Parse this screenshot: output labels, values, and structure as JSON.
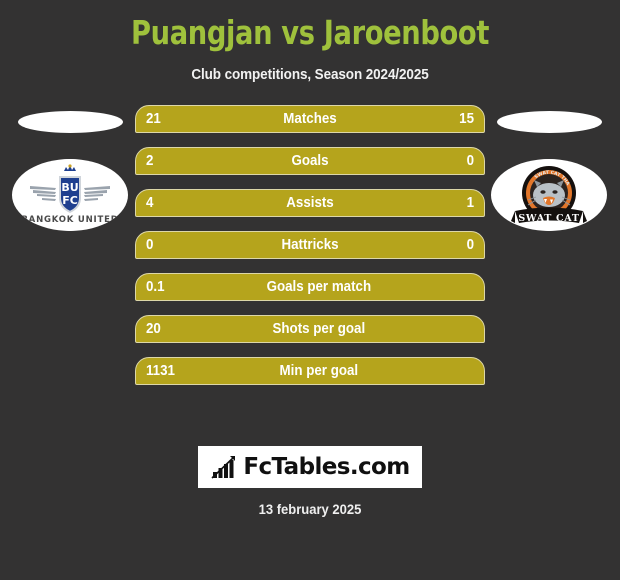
{
  "header": {
    "title": "Puangjan vs Jaroenboot",
    "subtitle": "Club competitions, Season 2024/2025",
    "title_color": "#9fc13c",
    "background_color": "#333232"
  },
  "teams": {
    "home": {
      "crest_name": "bangkok-united-crest",
      "crest_text": "BANGKOK UNITED",
      "crest_monogram_top": "BU",
      "crest_monogram_bottom": "FC",
      "crest_primary_color": "#1f3f8f"
    },
    "away": {
      "crest_name": "swat-cat-crest",
      "crest_text": "SWAT CAT",
      "crest_primary_color": "#e2762a"
    }
  },
  "stats": {
    "row_color": "#b5a41c",
    "row_border_color": "#ddd7a8",
    "rows": [
      {
        "label": "Matches",
        "home": "21",
        "away": "15",
        "has_away": true
      },
      {
        "label": "Goals",
        "home": "2",
        "away": "0",
        "has_away": true
      },
      {
        "label": "Assists",
        "home": "4",
        "away": "1",
        "has_away": true
      },
      {
        "label": "Hattricks",
        "home": "0",
        "away": "0",
        "has_away": true
      },
      {
        "label": "Goals per match",
        "home": "0.1",
        "away": "",
        "has_away": false
      },
      {
        "label": "Shots per goal",
        "home": "20",
        "away": "",
        "has_away": false
      },
      {
        "label": "Min per goal",
        "home": "1131",
        "away": "",
        "has_away": false
      }
    ]
  },
  "footer": {
    "brand": "FcTables.com",
    "brand_icon": "bar-chart-icon",
    "date": "13 february 2025"
  }
}
